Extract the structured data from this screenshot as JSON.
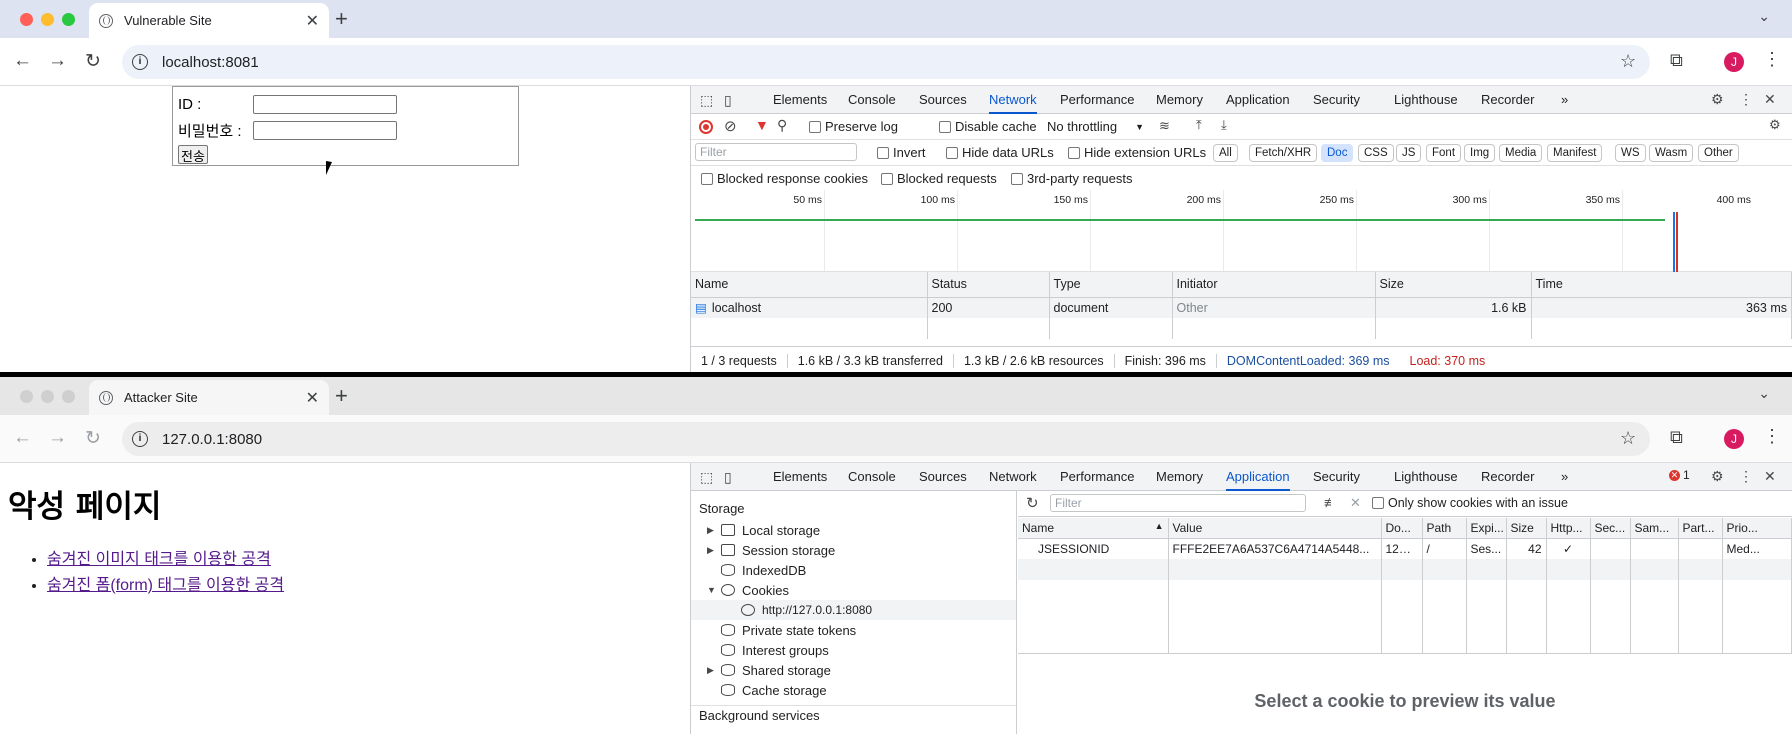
{
  "top": {
    "tab_title": "Vulnerable Site",
    "url": "localhost:8081",
    "avatar": "J",
    "form": {
      "id_label": "ID :",
      "pw_label": "비밀번호 :",
      "submit": "전송"
    },
    "devtools": {
      "tabs": [
        "Elements",
        "Console",
        "Sources",
        "Network",
        "Performance",
        "Memory",
        "Application",
        "Security",
        "Lighthouse",
        "Recorder"
      ],
      "active_tab": "Network",
      "more": "»",
      "preserve_log": "Preserve log",
      "disable_cache": "Disable cache",
      "throttling": "No throttling",
      "filter_placeholder": "Filter",
      "invert": "Invert",
      "hide_data_urls": "Hide data URLs",
      "hide_ext_urls": "Hide extension URLs",
      "chips": [
        "All",
        "Fetch/XHR",
        "Doc",
        "CSS",
        "JS",
        "Font",
        "Img",
        "Media",
        "Manifest",
        "WS",
        "Wasm",
        "Other"
      ],
      "active_chip": "Doc",
      "blocked_cookies": "Blocked response cookies",
      "blocked_requests": "Blocked requests",
      "third_party": "3rd-party requests",
      "timeline_ticks": [
        "50 ms",
        "100 ms",
        "150 ms",
        "200 ms",
        "250 ms",
        "300 ms",
        "350 ms",
        "400 ms"
      ],
      "columns": [
        "Name",
        "Status",
        "Type",
        "Initiator",
        "Size",
        "Time"
      ],
      "rows": [
        {
          "name": "localhost",
          "status": "200",
          "type": "document",
          "initiator": "Other",
          "size": "1.6 kB",
          "time": "363 ms"
        }
      ],
      "summary": {
        "requests": "1 / 3 requests",
        "transferred": "1.6 kB / 3.3 kB transferred",
        "resources": "1.3 kB / 2.6 kB resources",
        "finish": "Finish: 396 ms",
        "dcl": "DOMContentLoaded: 369 ms",
        "load": "Load: 370 ms"
      }
    }
  },
  "bottom": {
    "tab_title": "Attacker Site",
    "url": "127.0.0.1:8080",
    "avatar": "J",
    "heading": "악성 페이지",
    "links": [
      "숨겨진 이미지 태크를 이용한 공격",
      "숨겨진 폼(form) 태그를 이용한 공격"
    ],
    "devtools": {
      "active_tab": "Application",
      "error_count": "1",
      "storage_header": "Storage",
      "sidebar": [
        {
          "label": "Local storage",
          "expandable": true
        },
        {
          "label": "Session storage",
          "expandable": true
        },
        {
          "label": "IndexedDB",
          "expandable": false
        },
        {
          "label": "Cookies",
          "expandable": true
        },
        {
          "label": "http://127.0.0.1:8080",
          "expandable": false
        },
        {
          "label": "Private state tokens",
          "expandable": false
        },
        {
          "label": "Interest groups",
          "expandable": false
        },
        {
          "label": "Shared storage",
          "expandable": true
        },
        {
          "label": "Cache storage",
          "expandable": false
        },
        {
          "label": "Background services",
          "expandable": false
        }
      ],
      "filter_placeholder": "Filter",
      "only_issues": "Only show cookies with an issue",
      "columns": [
        "Name",
        "Value",
        "Do...",
        "Path",
        "Expi...",
        "Size",
        "Http...",
        "Sec...",
        "Sam...",
        "Part...",
        "Prio..."
      ],
      "cookies": [
        {
          "name": "JSESSIONID",
          "value": "FFFE2EE7A6A537C6A4714A5448...",
          "domain": "127....",
          "path": "/",
          "expires": "Ses...",
          "size": "42",
          "http": "✓",
          "secure": "",
          "samesite": "",
          "partition": "",
          "priority": "Med..."
        }
      ],
      "preview": "Select a cookie to preview its value"
    }
  }
}
